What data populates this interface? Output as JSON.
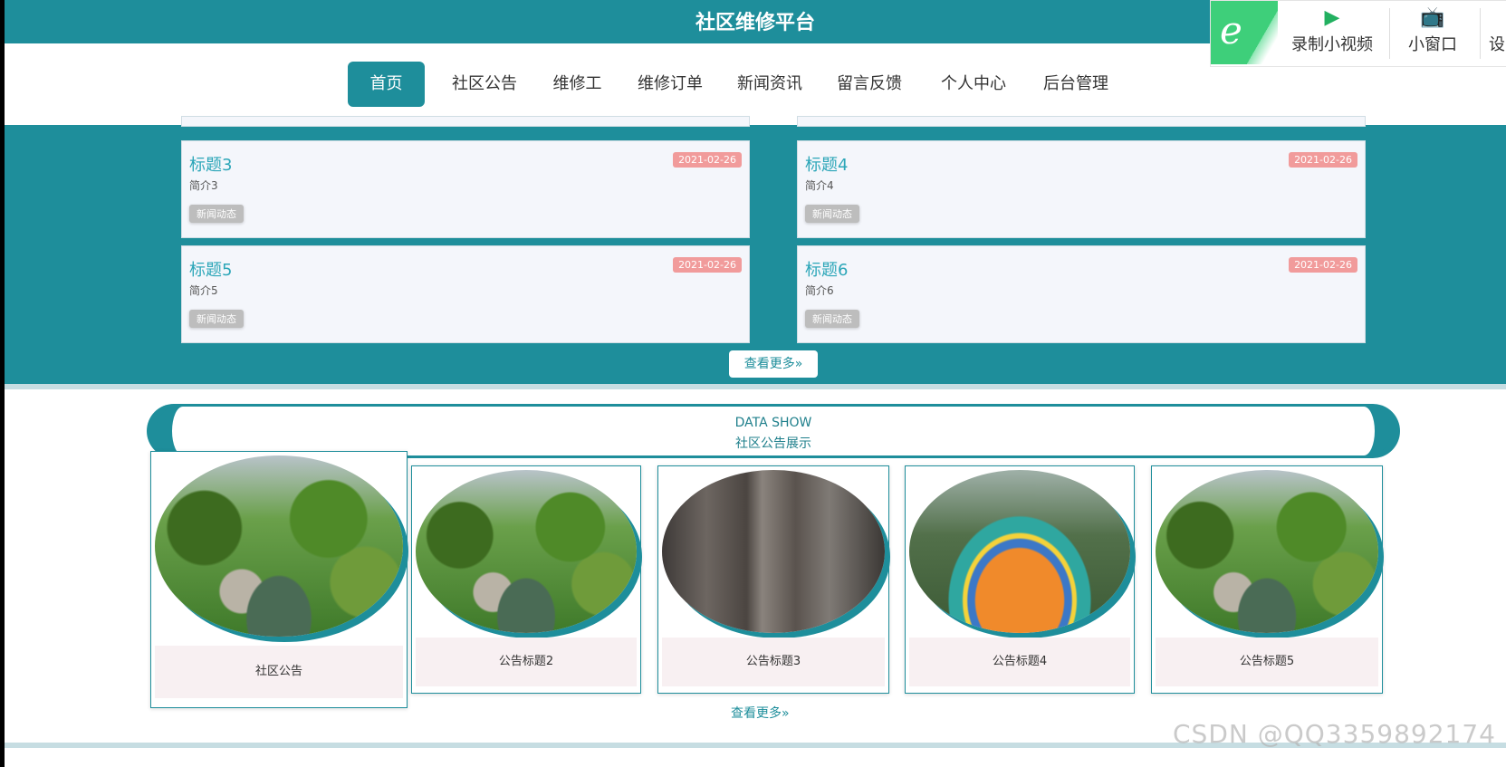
{
  "header": {
    "title": "社区维修平台"
  },
  "nav": {
    "items": [
      {
        "label": "首页",
        "active": true
      },
      {
        "label": "社区公告"
      },
      {
        "label": "维修工"
      },
      {
        "label": "维修订单"
      },
      {
        "label": "新闻资讯"
      },
      {
        "label": "留言反馈"
      },
      {
        "label": "个人中心"
      },
      {
        "label": "后台管理"
      }
    ]
  },
  "recorder": {
    "logo_icon": "e-browser-icon",
    "record_label": "录制小视频",
    "window_label": "小窗口",
    "third_label_partial": "设"
  },
  "news": {
    "items": [
      {
        "title": "标题3",
        "date": "2021-02-26",
        "summary": "简介3",
        "tag": "新闻动态"
      },
      {
        "title": "标题4",
        "date": "2021-02-26",
        "summary": "简介4",
        "tag": "新闻动态"
      },
      {
        "title": "标题5",
        "date": "2021-02-26",
        "summary": "简介5",
        "tag": "新闻动态"
      },
      {
        "title": "标题6",
        "date": "2021-02-26",
        "summary": "简介6",
        "tag": "新闻动态"
      }
    ],
    "more_label": "查看更多»"
  },
  "data_show": {
    "title_en": "DATA SHOW",
    "title_cn": "社区公告展示",
    "cards": [
      {
        "caption": "社区公告",
        "image": "garden"
      },
      {
        "caption": "公告标题2",
        "image": "garden"
      },
      {
        "caption": "公告标题3",
        "image": "elevator"
      },
      {
        "caption": "公告标题4",
        "image": "playground"
      },
      {
        "caption": "公告标题5",
        "image": "garden"
      }
    ],
    "more_label": "查看更多»"
  },
  "watermark": "CSDN @QQ3359892174",
  "colors": {
    "primary": "#1e8e9b",
    "date_badge": "#f19b9b",
    "tag": "#bdbdbd"
  }
}
